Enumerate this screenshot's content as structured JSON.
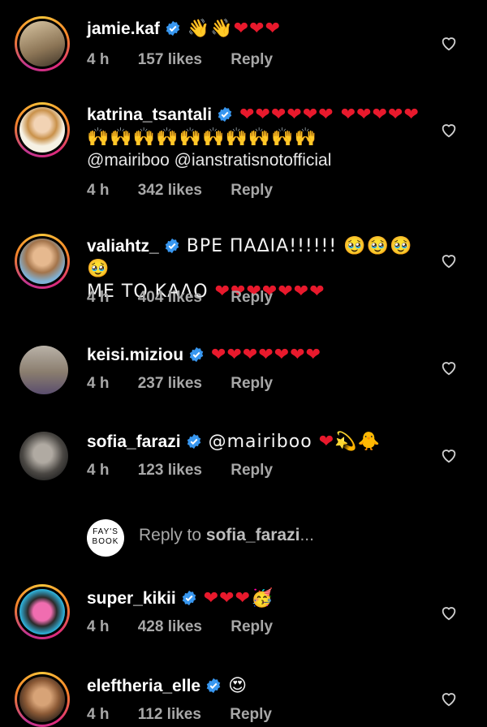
{
  "comments": [
    {
      "username": "jamie.kaf",
      "text": "👋👋❤❤❤",
      "time": "4 h",
      "likes": "157 likes",
      "reply": "Reply"
    },
    {
      "username": "katrina_tsantali",
      "text": "❤❤❤❤❤❤ ❤❤❤❤❤ 🙌🙌🙌🙌🙌🙌🙌🙌🙌🙌",
      "mentions": "@mairiboo @ianstratisnotofficial",
      "time": "4 h",
      "likes": "342 likes",
      "reply": "Reply"
    },
    {
      "username": "valiahtz_",
      "text": "ΒΡΕ ΠΑΔΙΑ!!!!!! 🥹🥹🥹🥹",
      "text2": "ΜΕ ΤΟ ΚΑΛΟ ❤❤❤❤❤❤❤",
      "time": "4 h",
      "likes": "404 likes",
      "reply": "Reply"
    },
    {
      "username": "keisi.miziou",
      "text": "❤❤❤❤❤❤❤",
      "time": "4 h",
      "likes": "237 likes",
      "reply": "Reply"
    },
    {
      "username": "sofia_farazi",
      "text": "@mairiboo ❤💫🐥",
      "time": "4 h",
      "likes": "123 likes",
      "reply": "Reply"
    },
    {
      "username": "super_kikii",
      "text": "❤❤❤🥳",
      "time": "4 h",
      "likes": "428 likes",
      "reply": "Reply"
    },
    {
      "username": "eleftheria_elle",
      "text": "😍",
      "time": "4 h",
      "likes": "112 likes",
      "reply": "Reply"
    }
  ],
  "reply_box": {
    "avatar_text": "FAY'S BOOK",
    "placeholder_prefix": "Reply to",
    "placeholder_user": "sofia_farazi",
    "placeholder_suffix": "..."
  },
  "colors": {
    "background": "#000000",
    "verified": "#3897f0",
    "heart": "#e8192c",
    "meta": "#a8a8a8"
  }
}
